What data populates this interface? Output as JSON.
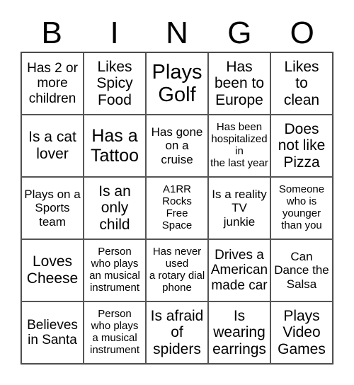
{
  "header": [
    "B",
    "I",
    "N",
    "G",
    "O"
  ],
  "cells": [
    {
      "text": "Has 2 or\nmore\nchildren",
      "size": "s19"
    },
    {
      "text": "Likes\nSpicy\nFood",
      "size": "s21"
    },
    {
      "text": "Plays\nGolf",
      "size": "s29"
    },
    {
      "text": "Has\nbeen to\nEurope",
      "size": "s21"
    },
    {
      "text": "Likes\nto\nclean",
      "size": "s21"
    },
    {
      "text": "Is a cat\nlover",
      "size": "s21"
    },
    {
      "text": "Has a\nTattoo",
      "size": "s25"
    },
    {
      "text": "Has gone\non a\ncruise",
      "size": "s17"
    },
    {
      "text": "Has been\nhospitalized\nin\nthe last year",
      "size": "s15"
    },
    {
      "text": "Does\nnot like\nPizza",
      "size": "s21"
    },
    {
      "text": "Plays on a\nSports\nteam",
      "size": "s17"
    },
    {
      "text": "Is an\nonly\nchild",
      "size": "s21"
    },
    {
      "text": "A1RR\nRocks\nFree\nSpace",
      "size": "s15"
    },
    {
      "text": "Is a reality\nTV\njunkie",
      "size": "s17"
    },
    {
      "text": "Someone\nwho is\nyounger\nthan you",
      "size": "s15"
    },
    {
      "text": "Loves\nCheese",
      "size": "s21"
    },
    {
      "text": "Person\nwho plays\nan musical\ninstrument",
      "size": "s15"
    },
    {
      "text": "Has never\nused\na rotary dial\nphone",
      "size": "s15"
    },
    {
      "text": "Drives a\nAmerican\nmade car",
      "size": "s19"
    },
    {
      "text": "Can\nDance the\nSalsa",
      "size": "s17"
    },
    {
      "text": "Believes\nin Santa",
      "size": "s19"
    },
    {
      "text": "Person\nwho plays\na musical\ninstrument",
      "size": "s15"
    },
    {
      "text": "Is afraid\nof\nspiders",
      "size": "s21"
    },
    {
      "text": "Is\nwearing\nearrings",
      "size": "s21"
    },
    {
      "text": "Plays\nVideo\nGames",
      "size": "s21"
    }
  ]
}
